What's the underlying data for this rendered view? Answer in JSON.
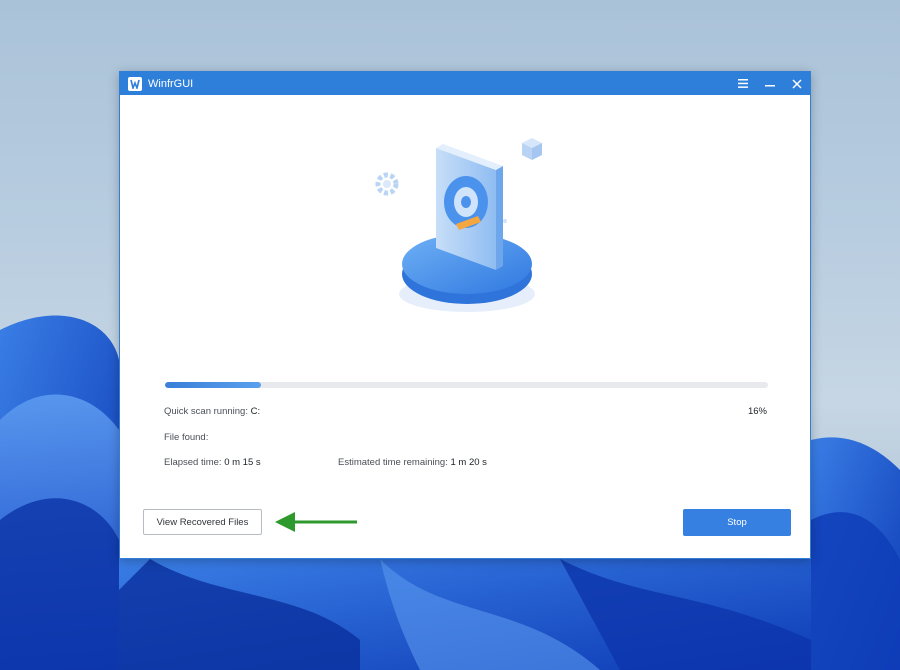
{
  "window": {
    "title": "WinfrGUI",
    "icon": "winfr-app-icon",
    "controls": [
      "menu-icon",
      "minimize-icon",
      "close-icon"
    ]
  },
  "scan": {
    "progress_percent": 16,
    "progress_label": "16%",
    "status_label": "Quick scan running",
    "status_value": "C:",
    "file_found_label": "File found",
    "elapsed_label": "Elapsed time",
    "elapsed_value": "0 m 15 s",
    "remaining_label": "Estimated time remaining",
    "remaining_value": "1 m 20 s"
  },
  "buttons": {
    "view_recovered": "View Recovered Files",
    "stop": "Stop"
  },
  "colors": {
    "titlebar": "#2d7fd9",
    "primary_button": "#3580e0",
    "progress_fill": "#3a7fd8",
    "annotation_arrow": "#2e9a2e"
  }
}
